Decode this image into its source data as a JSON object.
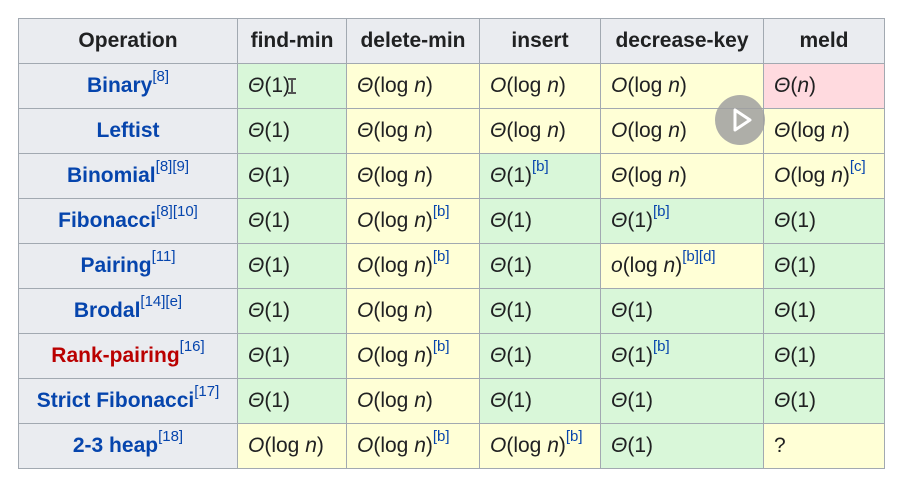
{
  "table": {
    "headers": [
      "Operation",
      "find-min",
      "delete-min",
      "insert",
      "decrease-key",
      "meld"
    ],
    "rows": [
      {
        "name": "Binary",
        "refs": "[8]",
        "link": "blue",
        "cells": [
          {
            "text": "Θ(1)",
            "ref": "",
            "color": "green"
          },
          {
            "text": "Θ(log n)",
            "ref": "",
            "color": "yellow"
          },
          {
            "text": "O(log n)",
            "ref": "",
            "color": "yellow"
          },
          {
            "text": "O(log n)",
            "ref": "",
            "color": "yellow"
          },
          {
            "text": "Θ(n)",
            "ref": "",
            "color": "red"
          }
        ]
      },
      {
        "name": "Leftist",
        "refs": "",
        "link": "blue",
        "cells": [
          {
            "text": "Θ(1)",
            "ref": "",
            "color": "green"
          },
          {
            "text": "Θ(log n)",
            "ref": "",
            "color": "yellow"
          },
          {
            "text": "Θ(log n)",
            "ref": "",
            "color": "yellow"
          },
          {
            "text": "O(log n)",
            "ref": "",
            "color": "yellow"
          },
          {
            "text": "Θ(log n)",
            "ref": "",
            "color": "yellow"
          }
        ]
      },
      {
        "name": "Binomial",
        "refs": "[8][9]",
        "link": "blue",
        "cells": [
          {
            "text": "Θ(1)",
            "ref": "",
            "color": "green"
          },
          {
            "text": "Θ(log n)",
            "ref": "",
            "color": "yellow"
          },
          {
            "text": "Θ(1)",
            "ref": "[b]",
            "color": "green"
          },
          {
            "text": "Θ(log n)",
            "ref": "",
            "color": "yellow"
          },
          {
            "text": "O(log n)",
            "ref": "[c]",
            "color": "yellow"
          }
        ]
      },
      {
        "name": "Fibonacci",
        "refs": "[8][10]",
        "link": "blue",
        "cells": [
          {
            "text": "Θ(1)",
            "ref": "",
            "color": "green"
          },
          {
            "text": "O(log n)",
            "ref": "[b]",
            "color": "yellow"
          },
          {
            "text": "Θ(1)",
            "ref": "",
            "color": "green"
          },
          {
            "text": "Θ(1)",
            "ref": "[b]",
            "color": "green"
          },
          {
            "text": "Θ(1)",
            "ref": "",
            "color": "green"
          }
        ]
      },
      {
        "name": "Pairing",
        "refs": "[11]",
        "link": "blue",
        "cells": [
          {
            "text": "Θ(1)",
            "ref": "",
            "color": "green"
          },
          {
            "text": "O(log n)",
            "ref": "[b]",
            "color": "yellow"
          },
          {
            "text": "Θ(1)",
            "ref": "",
            "color": "green"
          },
          {
            "text": "o(log n)",
            "ref": "[b][d]",
            "color": "yellow"
          },
          {
            "text": "Θ(1)",
            "ref": "",
            "color": "green"
          }
        ]
      },
      {
        "name": "Brodal",
        "refs": "[14][e]",
        "link": "blue",
        "cells": [
          {
            "text": "Θ(1)",
            "ref": "",
            "color": "green"
          },
          {
            "text": "O(log n)",
            "ref": "",
            "color": "yellow"
          },
          {
            "text": "Θ(1)",
            "ref": "",
            "color": "green"
          },
          {
            "text": "Θ(1)",
            "ref": "",
            "color": "green"
          },
          {
            "text": "Θ(1)",
            "ref": "",
            "color": "green"
          }
        ]
      },
      {
        "name": "Rank-pairing",
        "refs": "[16]",
        "link": "red",
        "cells": [
          {
            "text": "Θ(1)",
            "ref": "",
            "color": "green"
          },
          {
            "text": "O(log n)",
            "ref": "[b]",
            "color": "yellow"
          },
          {
            "text": "Θ(1)",
            "ref": "",
            "color": "green"
          },
          {
            "text": "Θ(1)",
            "ref": "[b]",
            "color": "green"
          },
          {
            "text": "Θ(1)",
            "ref": "",
            "color": "green"
          }
        ]
      },
      {
        "name": "Strict Fibonacci",
        "refs": "[17]",
        "link": "blue",
        "cells": [
          {
            "text": "Θ(1)",
            "ref": "",
            "color": "green"
          },
          {
            "text": "O(log n)",
            "ref": "",
            "color": "yellow"
          },
          {
            "text": "Θ(1)",
            "ref": "",
            "color": "green"
          },
          {
            "text": "Θ(1)",
            "ref": "",
            "color": "green"
          },
          {
            "text": "Θ(1)",
            "ref": "",
            "color": "green"
          }
        ]
      },
      {
        "name": "2-3 heap",
        "refs": "[18]",
        "link": "blue",
        "cells": [
          {
            "text": "O(log n)",
            "ref": "",
            "color": "yellow"
          },
          {
            "text": "O(log n)",
            "ref": "[b]",
            "color": "yellow"
          },
          {
            "text": "O(log n)",
            "ref": "[b]",
            "color": "yellow"
          },
          {
            "text": "Θ(1)",
            "ref": "",
            "color": "green"
          },
          {
            "text": "?",
            "ref": "",
            "color": "yellow"
          }
        ]
      }
    ]
  },
  "colors": {
    "green": "#d9f7d9",
    "yellow": "#ffffd6",
    "red": "#ffdadf",
    "link_blue": "#0645ad",
    "link_red": "#ba0000",
    "header_bg": "#eaecf0"
  },
  "overlay": {
    "play_icon": "play-icon",
    "cursor_icon": "text-cursor-icon"
  }
}
